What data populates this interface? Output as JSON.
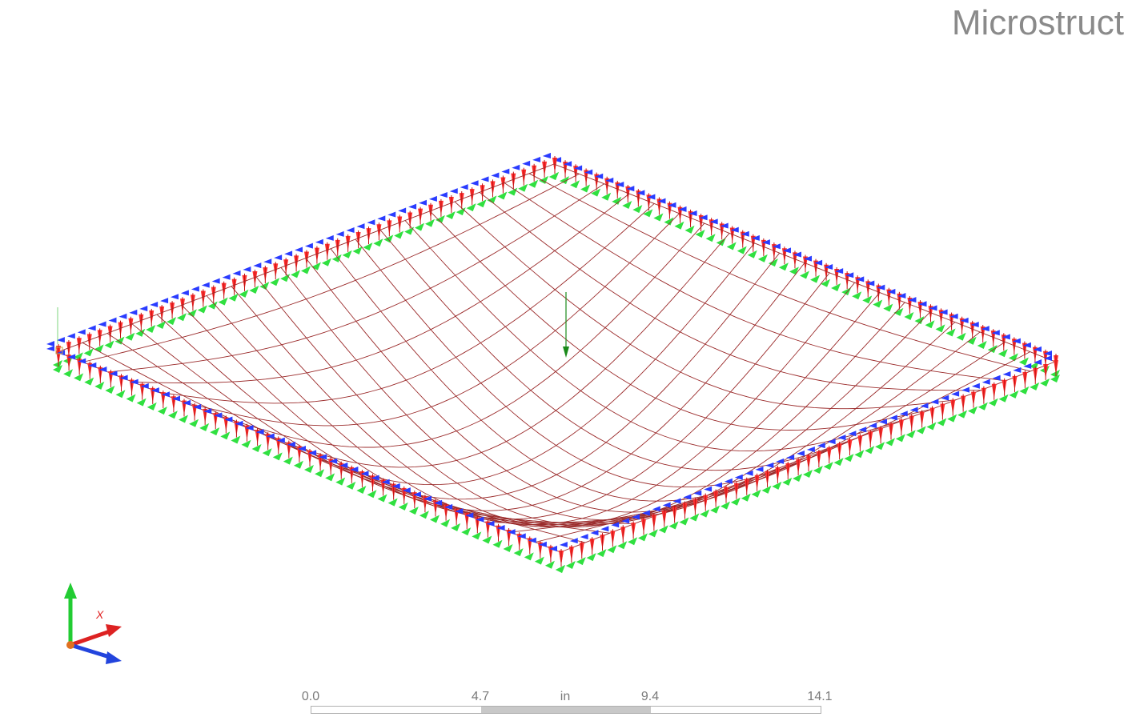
{
  "brand": {
    "text": "Microstruct"
  },
  "scale_bar": {
    "ticks": [
      "0.0",
      "4.7",
      "9.4",
      "14.1"
    ],
    "unit": "in"
  },
  "triad": {
    "x_label": "X"
  },
  "model": {
    "mesh_divisions": 20,
    "colors": {
      "mesh": "#9b2b2b",
      "constraint_red": "#ff3030",
      "constraint_green": "#30e040",
      "constraint_blue": "#2a3cff",
      "load_arrow": "#1a8a1a"
    }
  }
}
